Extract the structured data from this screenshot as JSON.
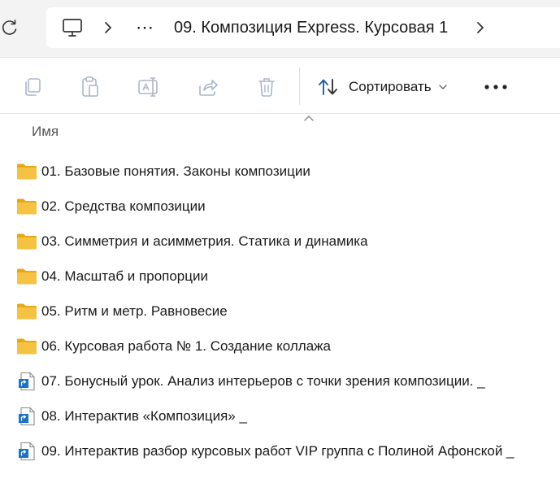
{
  "addressbar": {
    "refresh_icon": "refresh-icon",
    "computer_icon": "computer-icon",
    "overflow": "⋯",
    "current_folder": "09. Композиция Express. Курсовая 1"
  },
  "toolbar": {
    "copy_icon": "copy-icon",
    "paste_icon": "paste-icon",
    "rename_icon": "rename-icon",
    "share_icon": "share-icon",
    "delete_icon": "delete-icon",
    "sort_label": "Сортировать",
    "more_label": "•••"
  },
  "columns": {
    "name": "Имя"
  },
  "files": [
    {
      "name": "01. Базовые понятия. Законы композиции",
      "type": "folder"
    },
    {
      "name": "02. Средства композиции",
      "type": "folder"
    },
    {
      "name": "03. Симметрия и асимметрия. Статика и динамика",
      "type": "folder"
    },
    {
      "name": "04. Масштаб и пропорции",
      "type": "folder"
    },
    {
      "name": "05. Ритм и метр. Равновесие",
      "type": "folder"
    },
    {
      "name": "06. Курсовая работа № 1. Создание коллажа",
      "type": "folder"
    },
    {
      "name": "07. Бонусный урок. Анализ интерьеров с точки зрения композиции. _",
      "type": "shortcut"
    },
    {
      "name": "08. Интерактив «Композиция» _",
      "type": "shortcut"
    },
    {
      "name": "09. Интерактив разбор курсовых работ VIP группа с Полиной Афонской _",
      "type": "shortcut"
    }
  ],
  "colors": {
    "folder": "#f5c242",
    "folder_dark": "#e6a916",
    "accent": "#1a73c8",
    "disabled_icon": "#b4bcc8"
  }
}
